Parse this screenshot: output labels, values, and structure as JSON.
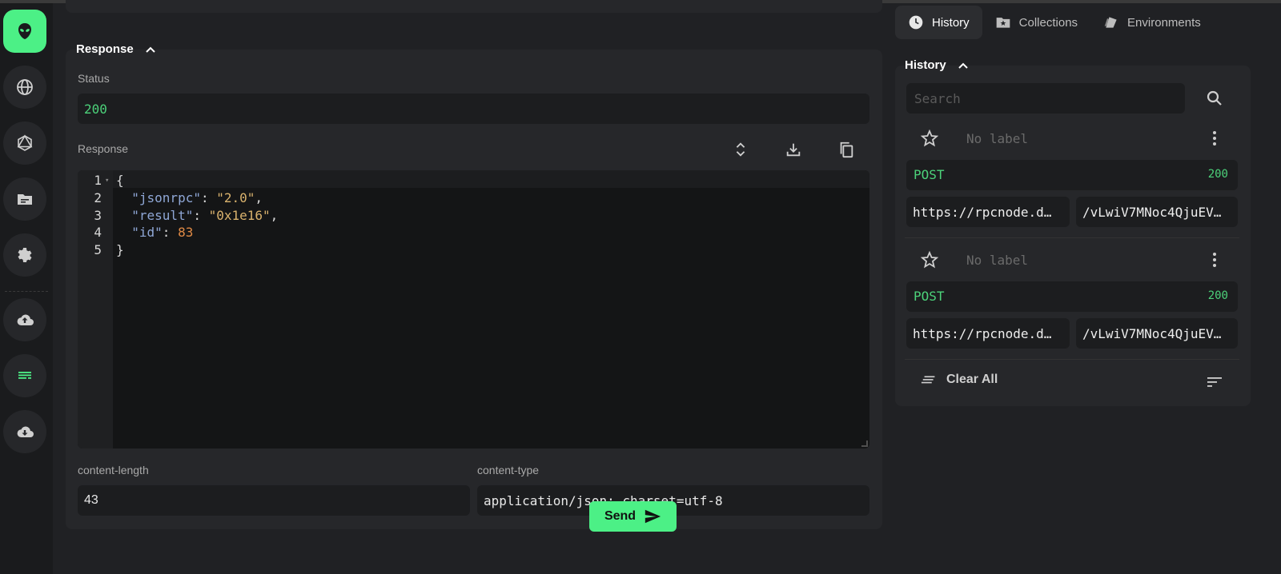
{
  "response": {
    "title": "Response",
    "status_label": "Status",
    "status_value": "200",
    "body_label": "Response",
    "line_numbers": [
      "1",
      "2",
      "3",
      "4",
      "5"
    ],
    "code": {
      "line1": "{",
      "line2_key": "\"jsonrpc\"",
      "line2_val": "\"2.0\"",
      "line3_key": "\"result\"",
      "line3_val": "\"0x1e16\"",
      "line4_key": "\"id\"",
      "line4_val": "83",
      "line5": "}"
    },
    "headers": [
      {
        "name": "content-length",
        "value": "43"
      },
      {
        "name": "content-type",
        "value": "application/json; charset=utf-8"
      }
    ]
  },
  "send_label": "Send",
  "tabs": [
    {
      "label": "History",
      "icon": "clock-icon",
      "active": true
    },
    {
      "label": "Collections",
      "icon": "folder-star-icon",
      "active": false
    },
    {
      "label": "Environments",
      "icon": "layers-icon",
      "active": false
    }
  ],
  "history": {
    "title": "History",
    "search_placeholder": "Search",
    "entries": [
      {
        "label": "No label",
        "method": "POST",
        "status": "200",
        "url": "https://rpcnode.d…",
        "path": "/vLwiV7MNoc4QjuEV…"
      },
      {
        "label": "No label",
        "method": "POST",
        "status": "200",
        "url": "https://rpcnode.d…",
        "path": "/vLwiV7MNoc4QjuEV…"
      }
    ],
    "clear_all": "Clear All"
  },
  "colors": {
    "accent": "#4cf086",
    "success": "#4cd27a"
  }
}
